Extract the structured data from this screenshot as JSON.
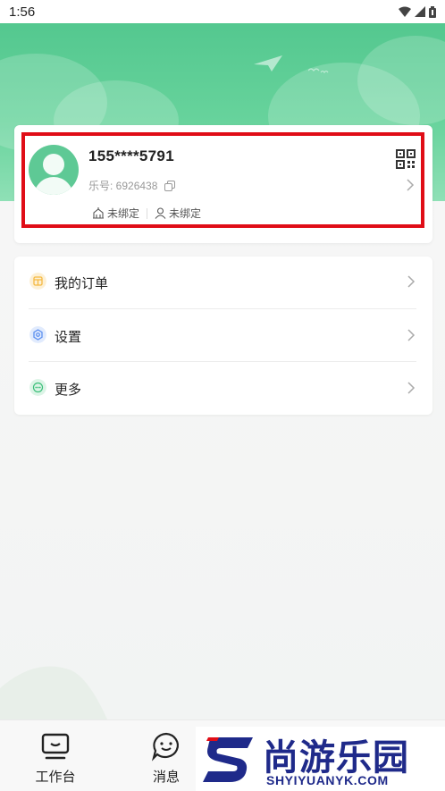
{
  "status_bar": {
    "time": "1:56"
  },
  "profile": {
    "phone": "155****5791",
    "uid_label": "乐号: 6926438",
    "bind_items": [
      "未绑定",
      "未绑定"
    ]
  },
  "menu": [
    {
      "label": "我的订单",
      "icon": "order-icon",
      "color": "#f5b942"
    },
    {
      "label": "设置",
      "icon": "settings-icon",
      "color": "#5b8ff0"
    },
    {
      "label": "更多",
      "icon": "more-icon",
      "color": "#3cbf7a"
    }
  ],
  "bottom_nav": [
    {
      "label": "工作台",
      "icon": "workbench-icon"
    },
    {
      "label": "消息",
      "icon": "message-icon"
    }
  ],
  "watermark": {
    "cn": "尚游乐园",
    "en": "SHYIYUANYK.COM"
  },
  "colors": {
    "brand_green": "#5ec995",
    "highlight_red": "#e00d17",
    "watermark_blue": "#1f2a8a"
  }
}
